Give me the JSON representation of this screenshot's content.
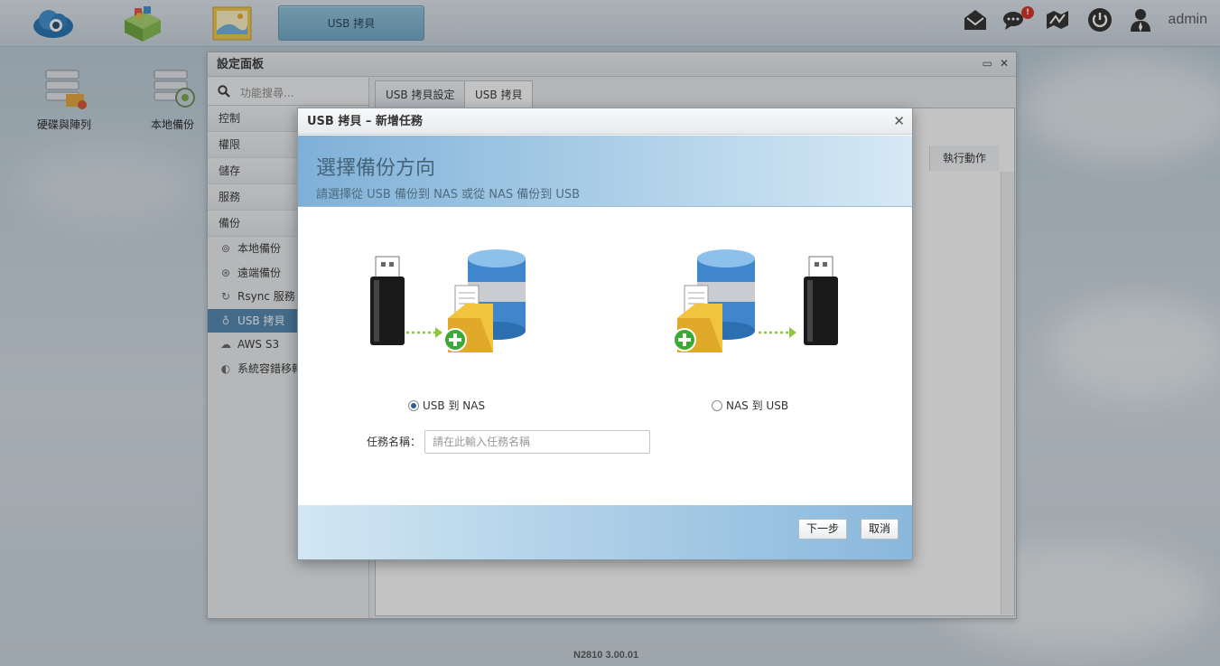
{
  "taskbar": {
    "active_app": "USB 拷貝",
    "notification_count": "!",
    "user": "admin"
  },
  "desktop": {
    "icons": [
      {
        "label": "硬碟與陣列"
      },
      {
        "label": "本地備份"
      }
    ]
  },
  "panel": {
    "title": "設定面板",
    "search_placeholder": "功能搜尋...",
    "categories": [
      "控制",
      "權限",
      "儲存",
      "服務",
      "備份"
    ],
    "backup_items": [
      {
        "label": "本地備份",
        "icon": "local-backup-icon"
      },
      {
        "label": "遠端備份",
        "icon": "remote-backup-icon"
      },
      {
        "label": "Rsync 服務",
        "icon": "rsync-icon"
      },
      {
        "label": "USB 拷貝",
        "icon": "usb-copy-icon",
        "active": true
      },
      {
        "label": "AWS S3",
        "icon": "cloud-icon"
      },
      {
        "label": "系統容錯移轉",
        "icon": "failover-icon"
      }
    ],
    "tabs": [
      "USB 拷貝設定",
      "USB 拷貝"
    ],
    "column_header": "執行動作"
  },
  "footer": {
    "version": "N2810   3.00.01"
  },
  "modal": {
    "title": "USB 拷貝 – 新增任務",
    "heading": "選擇備份方向",
    "subheading": "請選擇從 USB 備份到 NAS 或從 NAS 備份到 USB",
    "option_usb_to_nas": "USB 到 NAS",
    "option_nas_to_usb": "NAS 到 USB",
    "selected": "USB 到 NAS",
    "task_name_label": "任務名稱：",
    "task_name_placeholder": "請在此輸入任務名稱",
    "task_name_value": "",
    "next_button": "下一步",
    "cancel_button": "取消"
  },
  "colors": {
    "accent": "#4f86b0",
    "header_gradient_start": "#7fb0d8",
    "arrow_green": "#8cc63f",
    "plus_green": "#3aa935"
  }
}
